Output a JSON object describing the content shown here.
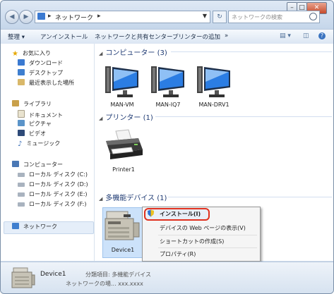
{
  "titlebar": {
    "address_sep1": "▸",
    "address_location": "ネットワーク",
    "address_sep2": "▸",
    "search_placeholder": "ネットワークの検索",
    "window_controls": [
      "–",
      "□",
      "✕"
    ]
  },
  "toolbar": {
    "items": [
      "整理 ▾",
      "アンインストール",
      "ネットワークと共有センター",
      "プリンターの追加",
      "»"
    ],
    "view_icon": "▤ ▾",
    "pane_icon": "◫",
    "help_icon": "?"
  },
  "sidebar": {
    "favorites": {
      "label": "お気に入り",
      "items": [
        "ダウンロード",
        "デスクトップ",
        "最近表示した場所"
      ]
    },
    "libraries": {
      "label": "ライブラリ",
      "items": [
        "ドキュメント",
        "ピクチャ",
        "ビデオ",
        "ミュージック"
      ]
    },
    "computer": {
      "label": "コンピューター",
      "items": [
        "ローカル ディスク (C:)",
        "ローカル ディスク (D:)",
        "ローカル ディスク (E:)",
        "ローカル ディスク (F:)"
      ]
    },
    "network": {
      "label": "ネットワーク"
    }
  },
  "groups": [
    {
      "title": "コンピューター (3)",
      "items": [
        "MAN-VM",
        "MAN-IQ7",
        "MAN-DRV1"
      ]
    },
    {
      "title": "プリンター (1)",
      "items": [
        "Printer1"
      ]
    },
    {
      "title": "多機能デバイス (1)",
      "items": [
        "Device1"
      ]
    }
  ],
  "context_menu": {
    "items": [
      "インストール(I)",
      "デバイスの Web ページの表示(V)",
      "ショートカットの作成(S)",
      "プロパティ(R)"
    ]
  },
  "details": {
    "name": "Device1",
    "category": "分類項目: 多機能デバイス",
    "location": "ネットワークの場... xxx.xxxx"
  },
  "colors": {
    "group_header": "#1e3a73",
    "context_highlight_border": "#e0301e",
    "selection": "#cce2fa"
  }
}
